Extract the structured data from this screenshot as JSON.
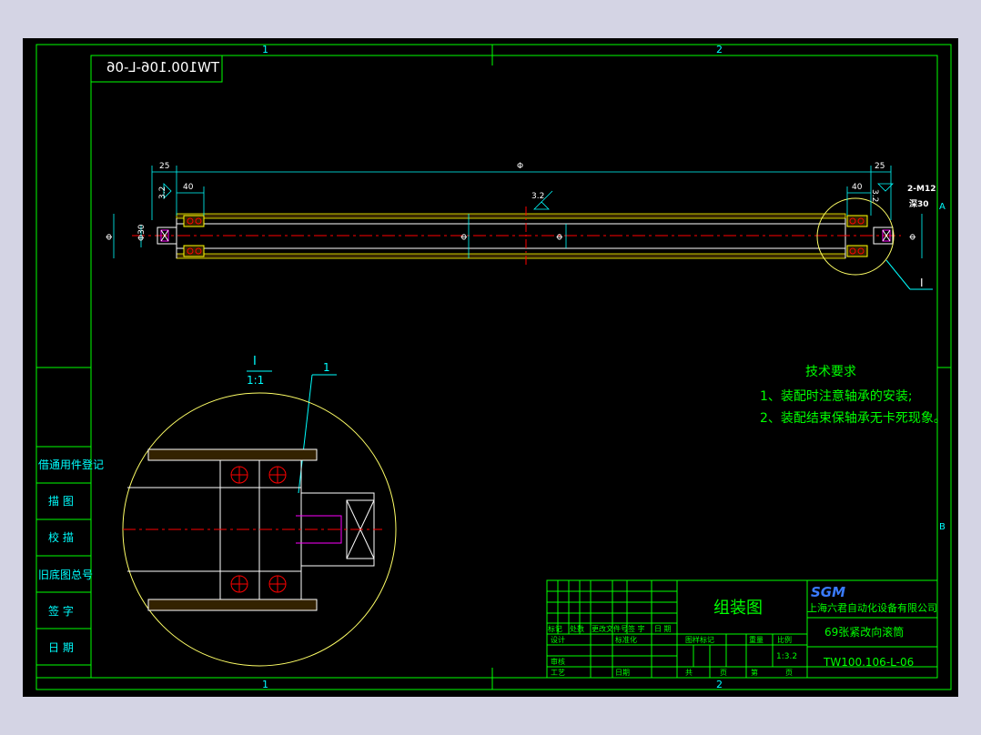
{
  "drawing": {
    "mirrored_title": "TW100.106-L-06",
    "zone_top_1": "1",
    "zone_top_2": "2",
    "zone_bottom_1": "1",
    "zone_bottom_2": "2",
    "zone_right_a": "A",
    "zone_right_b": "B",
    "colors": {
      "background": "#000000",
      "frame": "#00ff00",
      "cyan": "#00ffff",
      "red": "#ff0000",
      "yellow": "#ffff00",
      "magenta": "#ff00ff",
      "white": "#ffffff"
    }
  },
  "dimensions": {
    "left_25": "25",
    "right_25": "25",
    "total_phi": "Φ",
    "left_40": "40",
    "right_40": "40",
    "left_3_2": "3.2",
    "center_3_2": "3.2",
    "right_3_2": "3.2",
    "thread": "2-M12",
    "thread_depth": "深30",
    "left_dia_outer": "Φ",
    "left_dia_inner": "Φ30",
    "center_dia1": "Φ",
    "center_dia2": "Φ",
    "right_dia": "Φ",
    "detail_callout": "I"
  },
  "detail": {
    "label": "I",
    "scale": "1:1",
    "part_number": "1"
  },
  "requirements": {
    "title": "技术要求",
    "item1": "1、装配时注意轴承的安装;",
    "item2": "2、装配结束保轴承无卡死现象。"
  },
  "left_strip": {
    "cells": [
      "借通用件登记",
      "描 图",
      "校 描",
      "旧底图总号",
      "签 字",
      "日 期"
    ]
  },
  "title_block": {
    "drawing_name": "组装图",
    "company_logo": "SGM",
    "company": "上海六君自动化设备有限公司",
    "part_name": "69张紧改向滚筒",
    "drawing_number": "TW100.106-L-06",
    "scale_value": "1:3.2",
    "headers_row": [
      "标记",
      "处数",
      "更改文件号",
      "签 字",
      "日 期"
    ],
    "design": "设计",
    "standardize": "标准化",
    "review": "审核",
    "process": "工艺",
    "date": "日期",
    "stage_mark": "图样标记",
    "weight": "重量",
    "ratio": "比例",
    "total": "共",
    "sheets": "页",
    "sheet_no": "第",
    "sheets2": "页"
  }
}
